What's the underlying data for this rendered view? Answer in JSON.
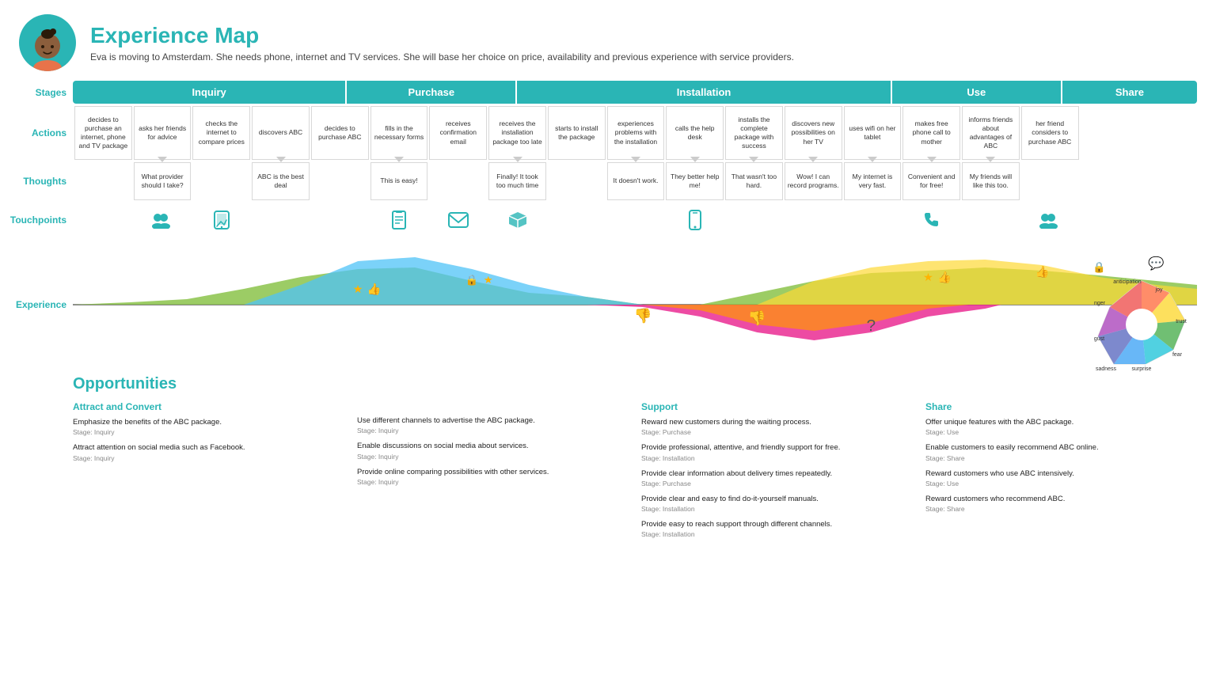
{
  "header": {
    "title": "Experience Map",
    "subtitle": "Eva is moving to Amsterdam. She needs phone, internet and TV services. She will base her choice on price, availability and previous experience with service providers."
  },
  "stages": [
    {
      "label": "Inquiry",
      "span": 4
    },
    {
      "label": "Purchase",
      "span": 3
    },
    {
      "label": "Installation",
      "span": 5
    },
    {
      "label": "Use",
      "span": 4
    },
    {
      "label": "Share",
      "span": 3
    }
  ],
  "row_labels": {
    "stages": "Stages",
    "actions": "Actions",
    "thoughts": "Thoughts",
    "touchpoints": "Touchpoints",
    "experience": "Experience"
  },
  "actions": [
    "decides to purchase an internet, phone and TV package",
    "asks her friends for advice",
    "checks the internet to compare prices",
    "discovers ABC",
    "decides to purchase ABC",
    "fills in the necessary forms",
    "receives confirmation email",
    "receives the installation package too late",
    "starts to install the package",
    "experiences problems with the installation",
    "calls the help desk",
    "installs the complete package with success",
    "discovers new possibilities on her TV",
    "uses wifi on her tablet",
    "makes free phone call to mother",
    "informs friends about advantages of ABC",
    "her friend considers to purchase ABC"
  ],
  "thoughts": [
    {
      "col": 1,
      "text": "What provider should I take?"
    },
    {
      "col": 3,
      "text": "ABC is the best deal"
    },
    {
      "col": 5,
      "text": "This is easy!"
    },
    {
      "col": 7,
      "text": "Finally! It took too much time"
    },
    {
      "col": 9,
      "text": "It doesn't work."
    },
    {
      "col": 10,
      "text": "They better help me!"
    },
    {
      "col": 11,
      "text": "That wasn't too hard."
    },
    {
      "col": 12,
      "text": "Wow! I can record programs."
    },
    {
      "col": 13,
      "text": "My internet is very fast."
    },
    {
      "col": 14,
      "text": "Convenient and for free!"
    },
    {
      "col": 15,
      "text": "My friends will like this too."
    }
  ],
  "touchpoints": [
    {
      "col": 1,
      "icon": "👥",
      "name": "friends"
    },
    {
      "col": 2,
      "icon": "📱",
      "name": "tablet"
    },
    {
      "col": 5,
      "icon": "📋",
      "name": "form"
    },
    {
      "col": 6,
      "icon": "✉️",
      "name": "email"
    },
    {
      "col": 7,
      "icon": "📦",
      "name": "package"
    },
    {
      "col": 10,
      "icon": "📱",
      "name": "phone"
    },
    {
      "col": 14,
      "icon": "📞",
      "name": "phone-call"
    },
    {
      "col": 15,
      "icon": "👥",
      "name": "friends2"
    }
  ],
  "opportunities": {
    "title": "Opportunities",
    "sections": [
      {
        "title": "Attract and Convert",
        "items": [
          {
            "text": "Emphasize the benefits of the ABC package.",
            "stage": "Stage: Inquiry"
          },
          {
            "text": "Attract attention on social media such as Facebook.",
            "stage": "Stage: Inquiry"
          },
          {
            "text": "Use different channels to advertise the ABC package.",
            "stage": "Stage: Inquiry"
          },
          {
            "text": "Enable discussions on social media about services.",
            "stage": "Stage: Inquiry"
          },
          {
            "text": "Provide online comparing possibilities with other services.",
            "stage": "Stage: Inquiry"
          }
        ]
      },
      {
        "title": "Support",
        "items": [
          {
            "text": "Reward new customers during the waiting process.",
            "stage": "Stage: Purchase"
          },
          {
            "text": "Provide professional, attentive, and friendly support for free.",
            "stage": "Stage: Installation"
          },
          {
            "text": "Provide clear information about delivery times repeatedly.",
            "stage": "Stage: Purchase"
          },
          {
            "text": "Provide clear and easy to find do-it-yourself manuals.",
            "stage": "Stage: Installation"
          },
          {
            "text": "Provide easy to reach support through different channels.",
            "stage": "Stage: Installation"
          }
        ]
      },
      {
        "title": "Share",
        "items": [
          {
            "text": "Offer unique features with the ABC package.",
            "stage": "Stage: Use"
          },
          {
            "text": "Enable customers to easily recommend ABC online.",
            "stage": "Stage: Share"
          },
          {
            "text": "Reward customers who use ABC intensively.",
            "stage": "Stage: Use"
          },
          {
            "text": "Reward customers who recommend ABC.",
            "stage": "Stage: Share"
          }
        ]
      }
    ]
  },
  "emotion_wheel": {
    "labels": [
      "joy",
      "trust",
      "fear",
      "surprise",
      "sadness",
      "disgust",
      "anger",
      "anticipation"
    ]
  }
}
